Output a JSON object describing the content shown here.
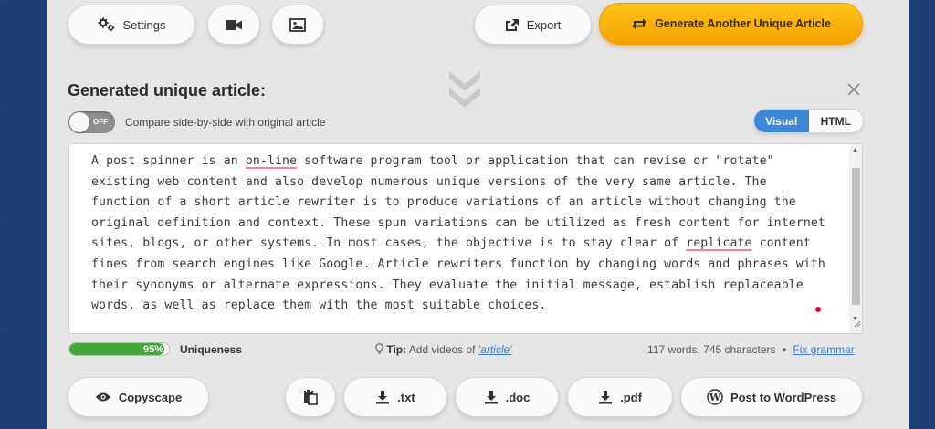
{
  "toolbar": {
    "settings_label": "Settings",
    "export_label": "Export",
    "generate_label": "Generate Another Unique Article"
  },
  "article": {
    "heading": "Generated unique article:",
    "compare_toggle_state": "OFF",
    "compare_label": "Compare side-by-side with original article",
    "view_modes": [
      "Visual",
      "HTML"
    ],
    "active_view": "Visual",
    "text_segments": [
      {
        "t": "A post spinner is an ",
        "err": false
      },
      {
        "t": "on-line",
        "err": true
      },
      {
        "t": " software program tool or application that can revise or \"rotate\" existing web content and also develop numerous unique versions of the very same article. The function of a short article rewriter is to produce variations of an article without changing the original definition and context. These spun variations can be utilized as fresh content for internet sites, blogs, or other systems. In most cases, the objective is to stay clear of ",
        "err": false
      },
      {
        "t": "replicate",
        "err": true
      },
      {
        "t": " content fines from search engines like Google. Article rewriters function by changing words and phrases with their synonyms or alternate expressions. They evaluate the initial message, establish replaceable words, as well as replace them with the most suitable choices.",
        "err": false
      }
    ]
  },
  "status": {
    "uniqueness_percent": 95,
    "uniqueness_text": "95%",
    "uniqueness_label": "Uniqueness",
    "tip_prefix": "Tip:",
    "tip_text": " Add videos of ",
    "tip_link": "'article'",
    "word_count": "117 words, 745 characters",
    "separator": "•",
    "fix_grammar": "Fix grammar"
  },
  "bottom": {
    "copyscape_label": "Copyscape",
    "txt_label": ".txt",
    "doc_label": ".doc",
    "pdf_label": ".pdf",
    "wordpress_label": "Post to WordPress"
  },
  "colors": {
    "accent_orange": "#f5a300",
    "active_blue": "#3d87d8",
    "progress_green": "#43a73c",
    "link_blue": "#3a7bd5",
    "error_underline": "#ff7c9c"
  }
}
